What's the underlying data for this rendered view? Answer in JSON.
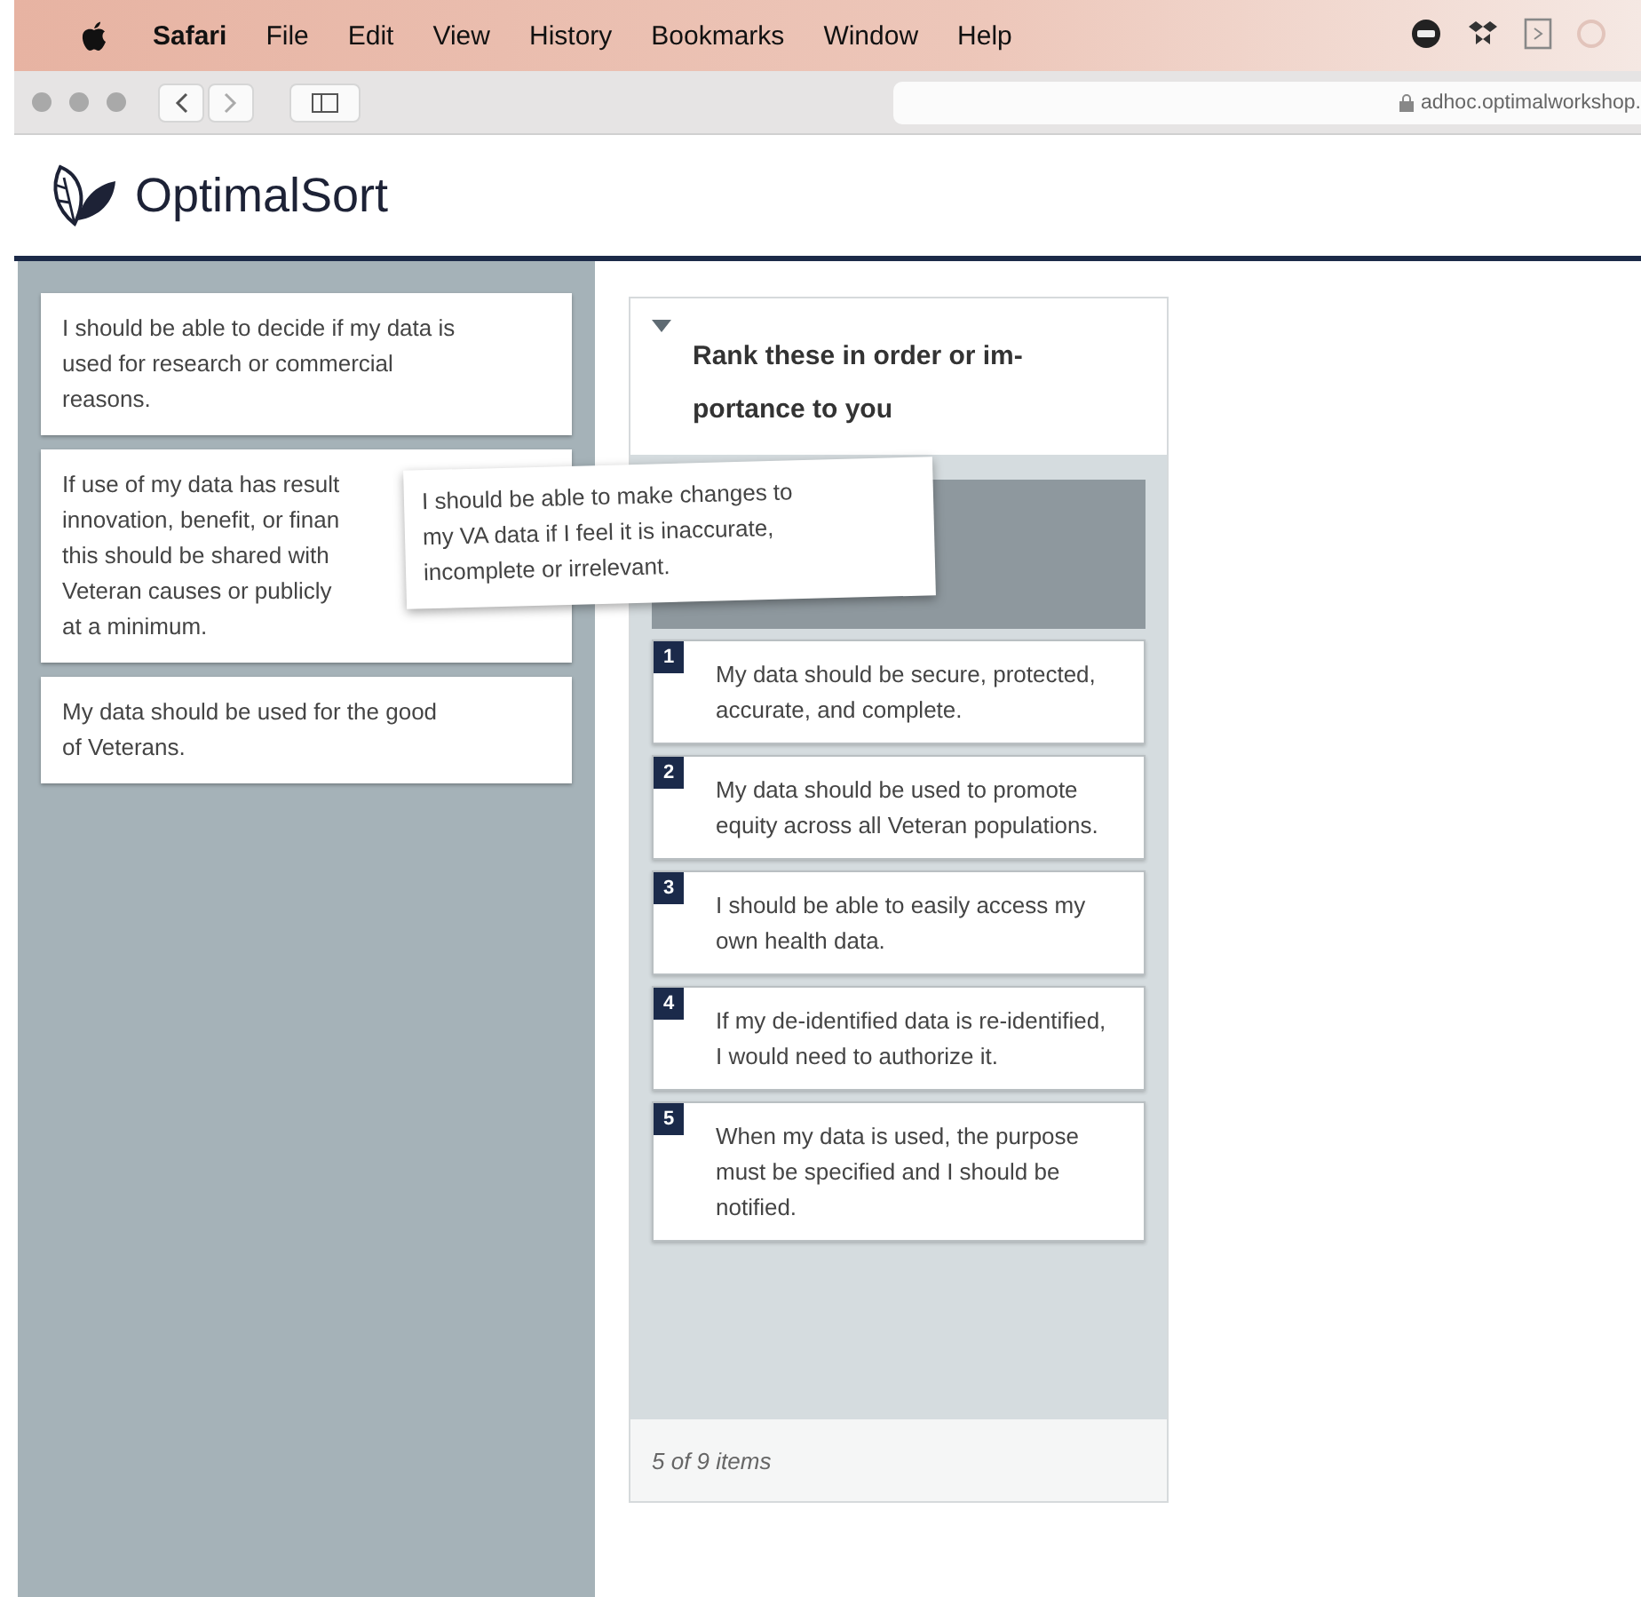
{
  "menu_bar": {
    "app_name": "Safari",
    "menus": [
      "File",
      "Edit",
      "View",
      "History",
      "Bookmarks",
      "Window",
      "Help"
    ]
  },
  "toolbar": {
    "address": "adhoc.optimalworkshop."
  },
  "brand": {
    "name": "OptimalSort"
  },
  "unsorted_cards": [
    {
      "lines": [
        "I should be able to decide if my data is",
        "used for research or commercial",
        "reasons."
      ]
    },
    {
      "lines": [
        "If use of my data has result",
        "innovation, benefit, or finan",
        "this should be shared with",
        "Veteran causes or publicly",
        "at a minimum."
      ]
    },
    {
      "lines": [
        "My data should be used for the good",
        "of Veterans."
      ]
    }
  ],
  "dragged_card": {
    "lines": [
      "I should be able to make changes to",
      "my VA data if I feel it is inaccurate,",
      "incomplete or irrelevant."
    ]
  },
  "ranking": {
    "expanded": true,
    "title_lines": [
      "Rank these in order or im-",
      "portance to you"
    ],
    "items": [
      {
        "rank": "1",
        "text": "My data should be secure, protected, accurate, and complete."
      },
      {
        "rank": "2",
        "text": "My data should be used to promote equity across all Veteran populations."
      },
      {
        "rank": "3",
        "text": "I should be able to easily access my own health data."
      },
      {
        "rank": "4",
        "text": "If my de-identified data is re-identified, I would need to authorize it."
      },
      {
        "rank": "5",
        "text": "When my data is used, the purpose must be specified and I should be notified."
      }
    ],
    "footer": "5 of 9 items"
  }
}
